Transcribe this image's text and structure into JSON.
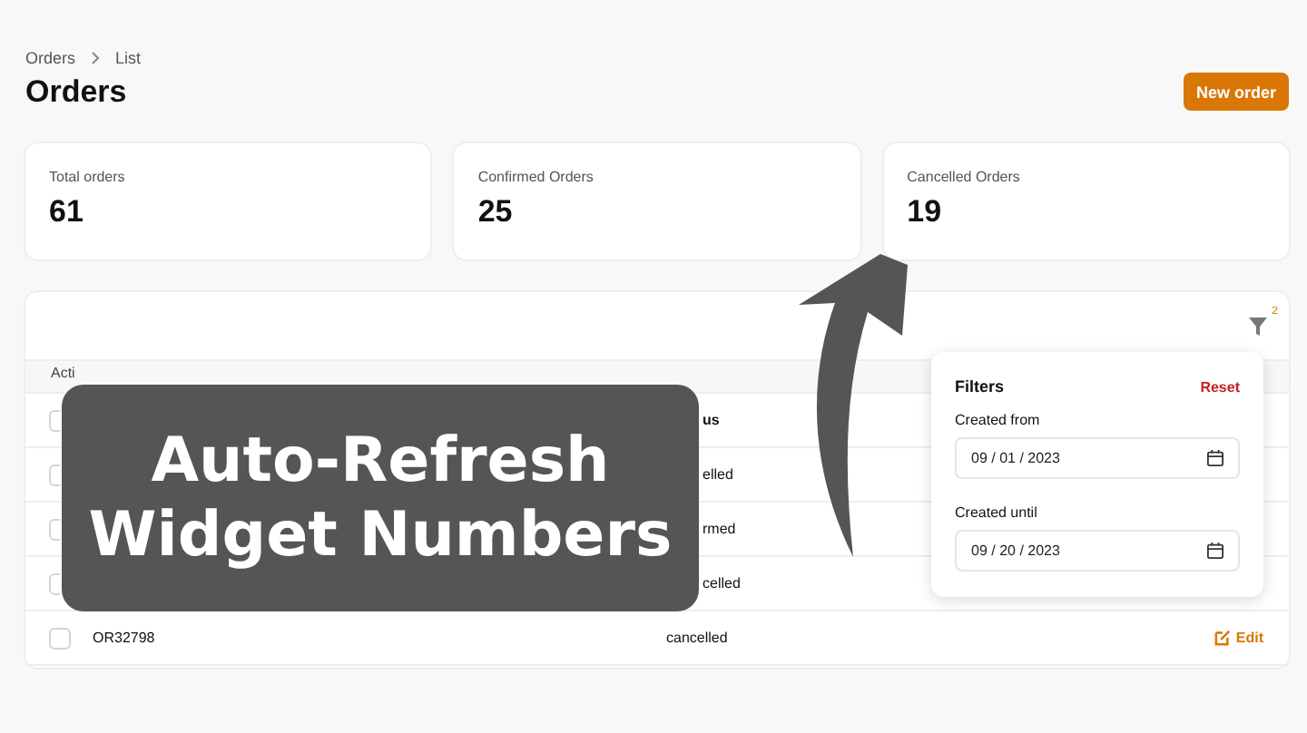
{
  "breadcrumbs": [
    {
      "label": "Orders"
    },
    {
      "label": "List"
    }
  ],
  "page_title": "Orders",
  "new_order_button": "New order",
  "stats": [
    {
      "label": "Total orders",
      "value": "61"
    },
    {
      "label": "Confirmed Orders",
      "value": "25"
    },
    {
      "label": "Cancelled Orders",
      "value": "19"
    }
  ],
  "table": {
    "filter_count": "2",
    "actions_header": "Acti",
    "status_header": "us",
    "header_checked": false,
    "rows": [
      {
        "kind": "partial",
        "status": "elled",
        "checked": false
      },
      {
        "kind": "partial",
        "status": "rmed",
        "checked": false
      },
      {
        "kind": "partial",
        "status": "celled",
        "checked": false
      },
      {
        "kind": "full",
        "number": "OR32798",
        "status": "cancelled",
        "checked": false,
        "action": "Edit"
      }
    ]
  },
  "filters": {
    "title": "Filters",
    "reset": "Reset",
    "fields": [
      {
        "label": "Created from",
        "value": "09 / 01 / 2023"
      },
      {
        "label": "Created until",
        "value": "09 / 20 / 2023"
      }
    ]
  },
  "overlay": {
    "caption_lines": [
      "Auto-Refresh",
      "Widget Numbers"
    ]
  }
}
